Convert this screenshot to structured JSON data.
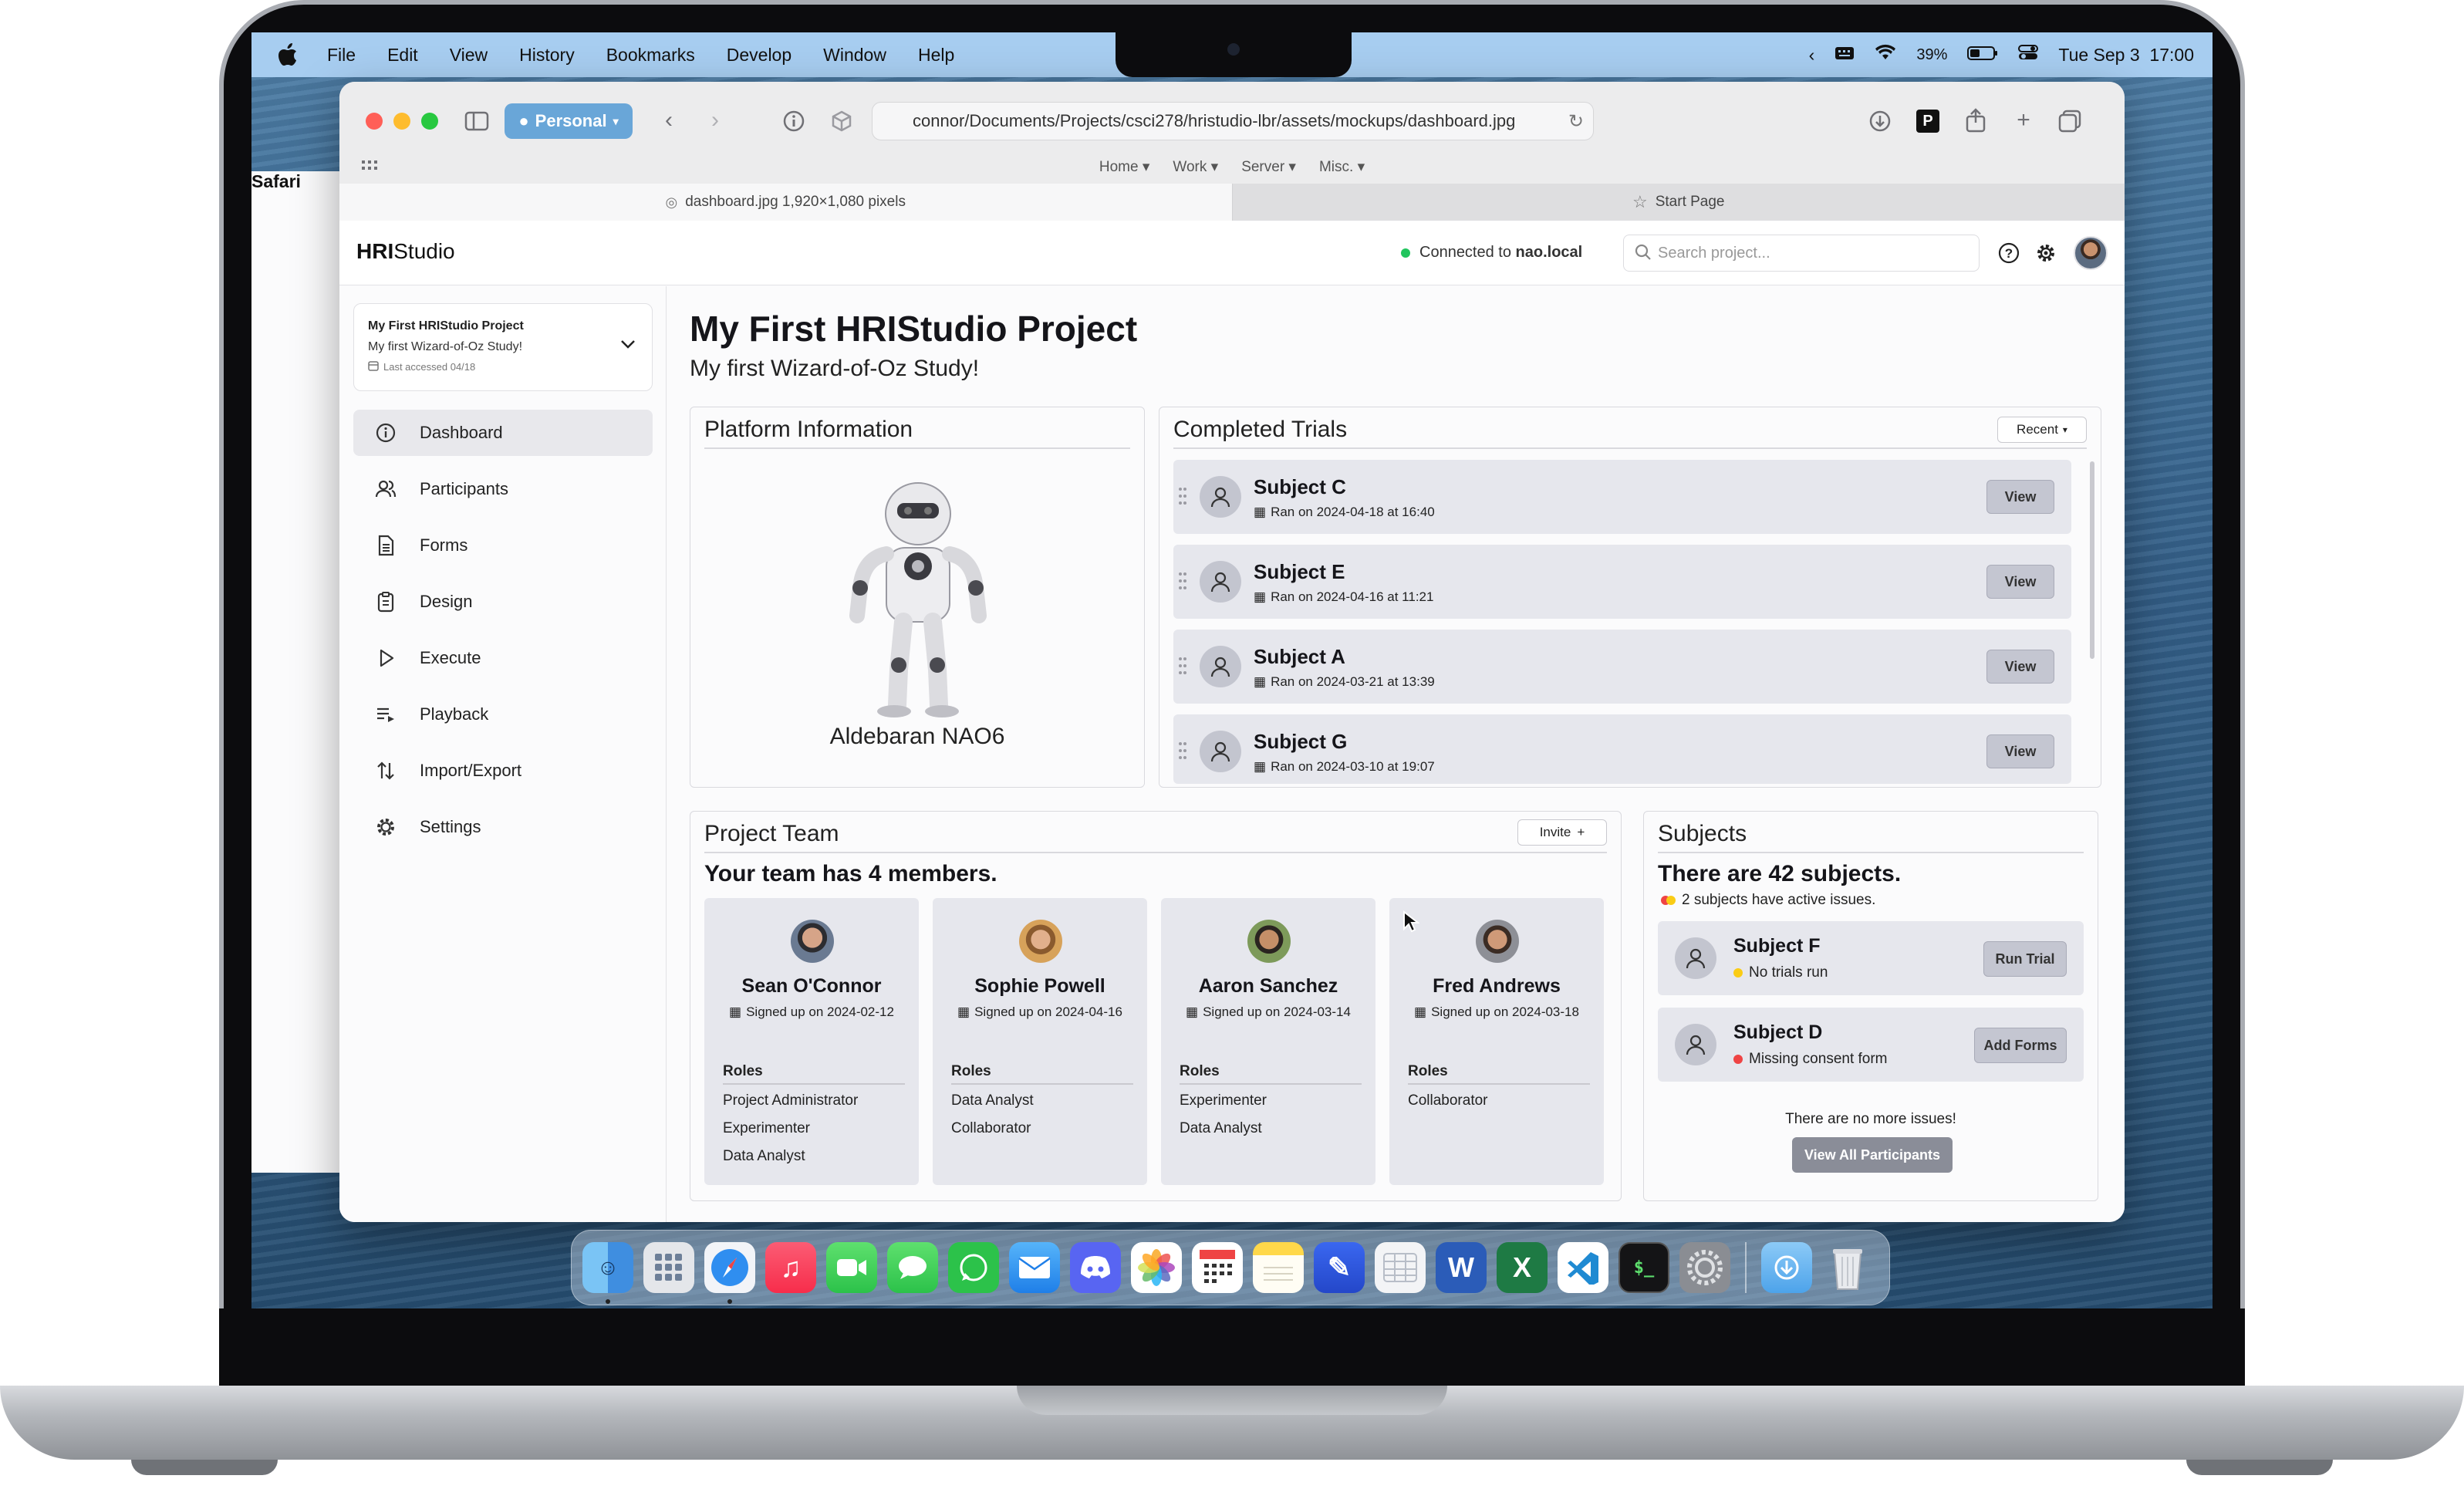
{
  "menubar": {
    "app_name": "Safari",
    "items": [
      "File",
      "Edit",
      "View",
      "History",
      "Bookmarks",
      "Develop",
      "Window",
      "Help"
    ],
    "battery": "39%",
    "datetime": "Tue Sep 3  17:00"
  },
  "browser": {
    "profile": "Personal",
    "url": "connor/Documents/Projects/csci278/hristudio-lbr/assets/mockups/dashboard.jpg",
    "bookmarks": [
      "Home",
      "Work",
      "Server",
      "Misc."
    ],
    "tabs": [
      {
        "label": "dashboard.jpg 1,920×1,080 pixels",
        "active": true
      },
      {
        "label": "Start Page",
        "active": false
      }
    ]
  },
  "app": {
    "logo_bold": "HRI",
    "logo_rest": "Studio",
    "connection_prefix": "Connected to",
    "connection_host": "nao.local",
    "search_placeholder": "Search project...",
    "project_selector": {
      "title": "My First HRIStudio Project",
      "subtitle": "My first Wizard-of-Oz Study!",
      "last_accessed": "Last accessed 04/18"
    },
    "nav": [
      {
        "label": "Dashboard",
        "icon": "info-icon",
        "active": true
      },
      {
        "label": "Participants",
        "icon": "users-icon"
      },
      {
        "label": "Forms",
        "icon": "file-text-icon"
      },
      {
        "label": "Design",
        "icon": "clipboard-icon"
      },
      {
        "label": "Execute",
        "icon": "play-icon"
      },
      {
        "label": "Playback",
        "icon": "list-play-icon"
      },
      {
        "label": "Import/Export",
        "icon": "arrows-updown-icon"
      },
      {
        "label": "Settings",
        "icon": "gear-icon"
      }
    ],
    "page_title": "My First HRIStudio Project",
    "page_subtitle": "My first Wizard-of-Oz Study!",
    "platform": {
      "title": "Platform Information",
      "robot_name": "Aldebaran NAO6"
    },
    "completed_trials": {
      "title": "Completed Trials",
      "sort_label": "Recent",
      "view_label": "View",
      "items": [
        {
          "name": "Subject C",
          "meta": "Ran on 2024-04-18 at 16:40"
        },
        {
          "name": "Subject E",
          "meta": "Ran on 2024-04-16 at 11:21"
        },
        {
          "name": "Subject A",
          "meta": "Ran on 2024-03-21 at 13:39"
        },
        {
          "name": "Subject G",
          "meta": "Ran on 2024-03-10 at 19:07"
        }
      ]
    },
    "team": {
      "title": "Project Team",
      "invite_label": "Invite",
      "count_text": "Your team has 4 members.",
      "roles_label": "Roles",
      "members": [
        {
          "name": "Sean O'Connor",
          "signed": "Signed up on 2024-02-12",
          "roles": [
            "Project Administrator",
            "Experimenter",
            "Data Analyst"
          ]
        },
        {
          "name": "Sophie Powell",
          "signed": "Signed up on 2024-04-16",
          "roles": [
            "Data Analyst",
            "Collaborator"
          ]
        },
        {
          "name": "Aaron Sanchez",
          "signed": "Signed up on 2024-03-14",
          "roles": [
            "Experimenter",
            "Data Analyst"
          ]
        },
        {
          "name": "Fred Andrews",
          "signed": "Signed up on 2024-03-18",
          "roles": [
            "Collaborator"
          ]
        }
      ]
    },
    "subjects": {
      "title": "Subjects",
      "count_text": "There are 42 subjects.",
      "issues_text": "2 subjects have active issues.",
      "items": [
        {
          "name": "Subject F",
          "status": "No trials run",
          "status_color": "#facc15",
          "action": "Run Trial"
        },
        {
          "name": "Subject D",
          "status": "Missing consent form",
          "status_color": "#ef4444",
          "action": "Add Forms"
        }
      ],
      "no_more_text": "There are no more issues!",
      "view_all_label": "View All Participants"
    }
  },
  "dock": [
    "Finder",
    "Launchpad",
    "Safari",
    "Music",
    "FaceTime",
    "Messages",
    "WhatsApp",
    "Mail",
    "Discord",
    "Photos",
    "Calendar",
    "Notes",
    "Pencil",
    "Numbers",
    "Word",
    "Excel",
    "VS Code",
    "Terminal",
    "System Settings",
    "Downloads",
    "Trash"
  ]
}
